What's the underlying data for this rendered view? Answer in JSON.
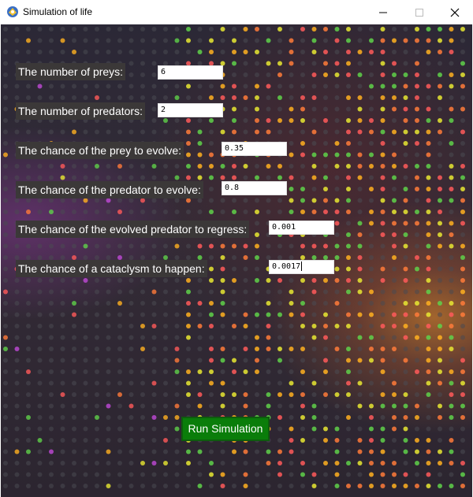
{
  "window": {
    "title": "Simulation of life",
    "minimize_glyph": "—",
    "maximize_glyph": "☐",
    "close_glyph": "✕"
  },
  "form": {
    "fields": [
      {
        "label": "The number of preys:",
        "value": "6"
      },
      {
        "label": "The number of predators:",
        "value": "2"
      },
      {
        "label": "The chance of the prey to evolve:",
        "value": "0.35"
      },
      {
        "label": "The chance of the predator to evolve:",
        "value": "0.8"
      },
      {
        "label": "The chance of the evolved predator to regress:",
        "value": "0.001"
      },
      {
        "label": "The chance of a cataclysm to happen:",
        "value": "0.0017"
      }
    ],
    "run_button": "Run Simulation"
  },
  "colors": {
    "label_bg": "#3b3838",
    "button_bg": "#0a7d0a",
    "dot_palette": [
      "#ff5a5a",
      "#ffb020",
      "#e8e832",
      "#5fd14a",
      "#ff7b3a",
      "#c04ad8",
      "#4a4a52"
    ]
  }
}
